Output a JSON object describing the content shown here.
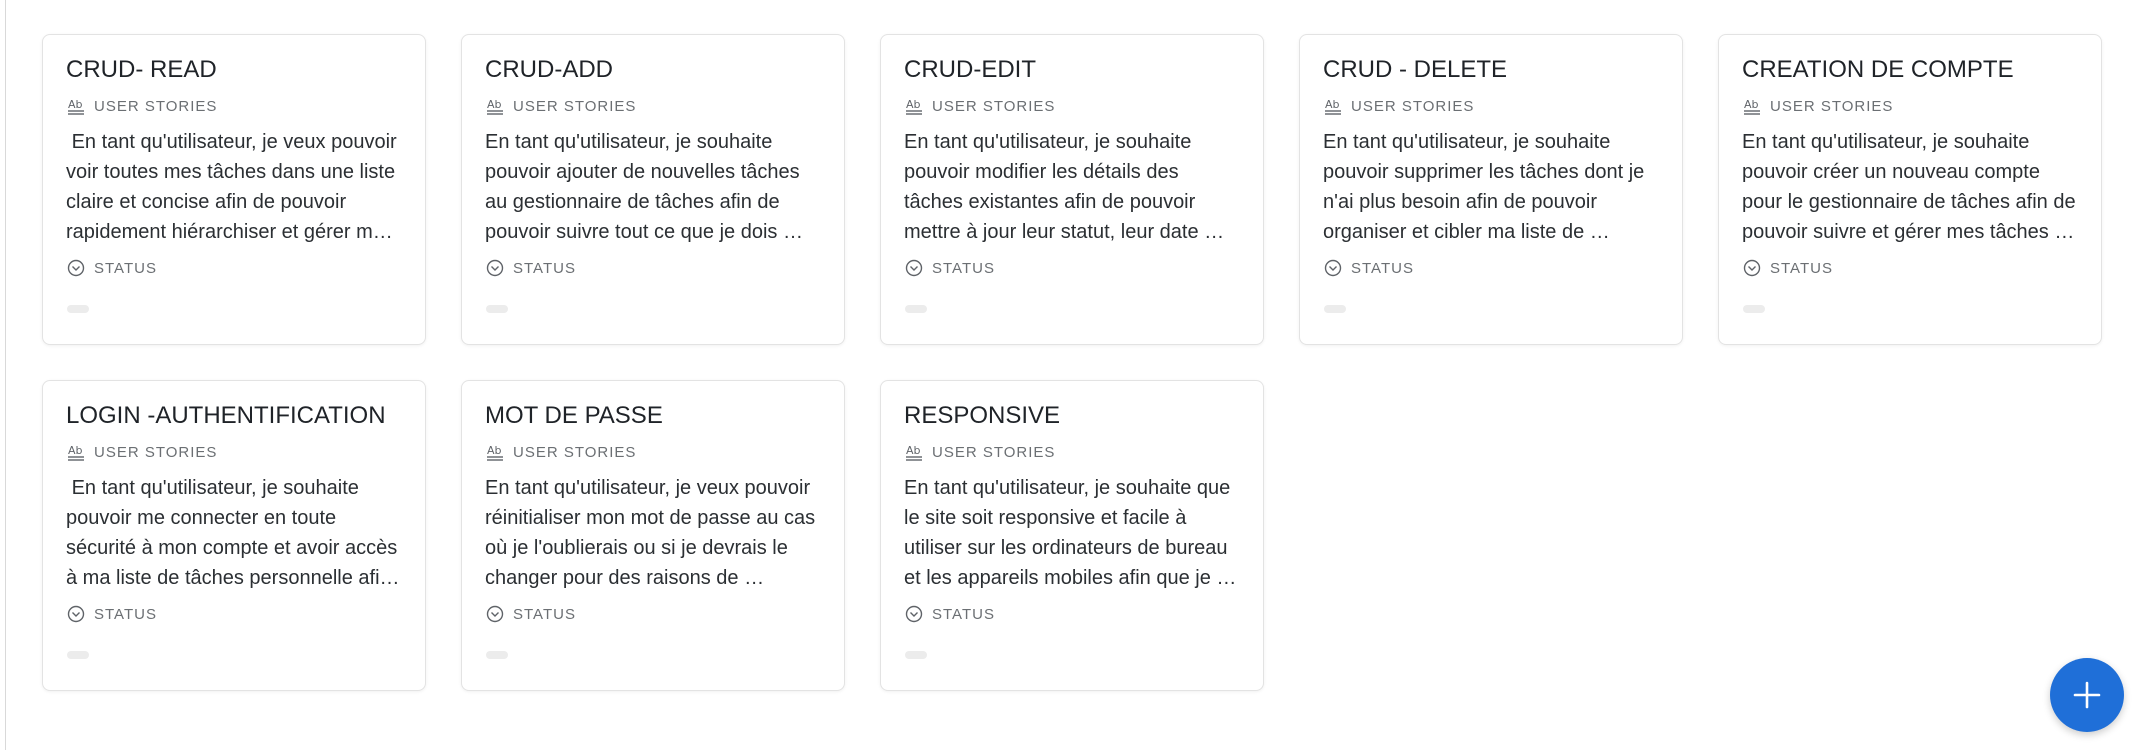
{
  "property_labels": {
    "type": "USER STORIES",
    "status": "STATUS"
  },
  "icons": {
    "type": "text-format-icon",
    "status": "status-circle-chevron-icon",
    "fab": "plus-icon"
  },
  "colors": {
    "fab": "#1f6fd8",
    "card_border": "#e3e3e3",
    "status_chip": "#ececec"
  },
  "cards": [
    {
      "title": "CRUD- READ",
      "text": " En tant qu'utilisateur, je veux pouvoir voir toutes mes tâches dans une liste claire et concise afin de pouvoir rapidement hiérarchiser et gérer ma …"
    },
    {
      "title": "CRUD-ADD",
      "text": "En tant qu'utilisateur, je souhaite pouvoir ajouter de nouvelles tâches au gestionnaire de tâches afin de pouvoir suivre tout ce que je dois …"
    },
    {
      "title": "CRUD-EDIT",
      "text": "En tant qu'utilisateur, je souhaite pouvoir modifier les détails des tâches existantes afin de pouvoir mettre à jour leur statut, leur date d'échéance…"
    },
    {
      "title": "CRUD - DELETE",
      "text": "En tant qu'utilisateur, je souhaite pouvoir supprimer les tâches dont je n'ai plus besoin afin de pouvoir organiser et cibler ma liste de tâches…"
    },
    {
      "title": "CREATION DE COMPTE",
      "text": "En tant qu'utilisateur, je souhaite pouvoir créer un nouveau compte pour le gestionnaire de tâches afin de pouvoir suivre et gérer mes tâches d…"
    },
    {
      "title": "LOGIN -AUTHENTIFICATION",
      "text": " En tant qu'utilisateur, je souhaite pouvoir me connecter en toute sécurité à mon compte et avoir accès à ma liste de tâches personnelle afin …"
    },
    {
      "title": "MOT DE PASSE",
      "text": "En tant qu'utilisateur, je veux pouvoir réinitialiser mon mot de passe au cas où je l'oublierais ou si je devrais le changer pour des raisons de sécurité…"
    },
    {
      "title": "RESPONSIVE",
      "text": "En tant qu'utilisateur, je souhaite que le site soit responsive et facile à utiliser sur les ordinateurs de bureau et les appareils mobiles afin que je …"
    }
  ]
}
